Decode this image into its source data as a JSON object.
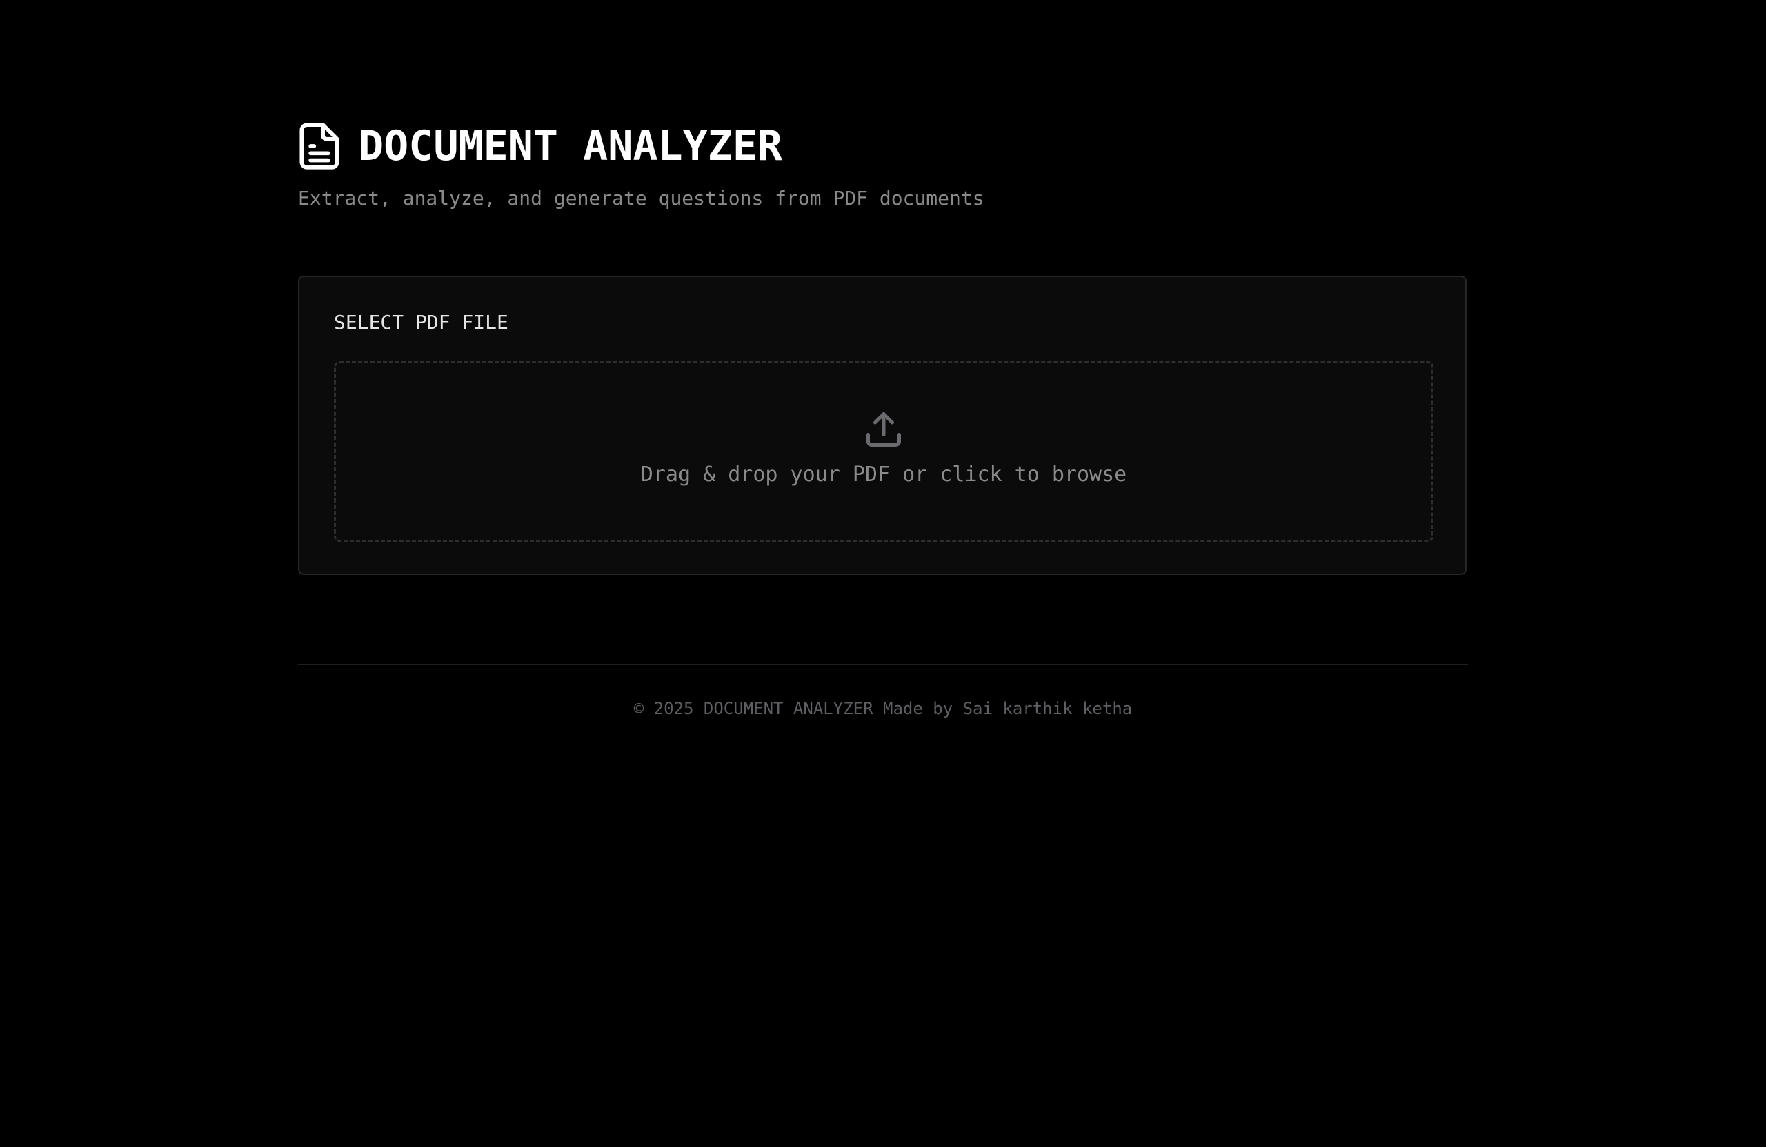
{
  "header": {
    "title": "DOCUMENT ANALYZER",
    "subtitle": "Extract, analyze, and generate questions from PDF documents",
    "icon": "file-text-icon"
  },
  "upload": {
    "label": "SELECT PDF FILE",
    "dropzone_text": "Drag & drop your PDF or click to browse",
    "icon": "upload-icon"
  },
  "footer": {
    "text": "© 2025 DOCUMENT ANALYZER Made by Sai karthik ketha"
  },
  "colors": {
    "background": "#000000",
    "card": "#0b0b0c",
    "title": "#ffffff",
    "muted_text": "#8a8a8a",
    "footer_text": "#5f5f63"
  }
}
